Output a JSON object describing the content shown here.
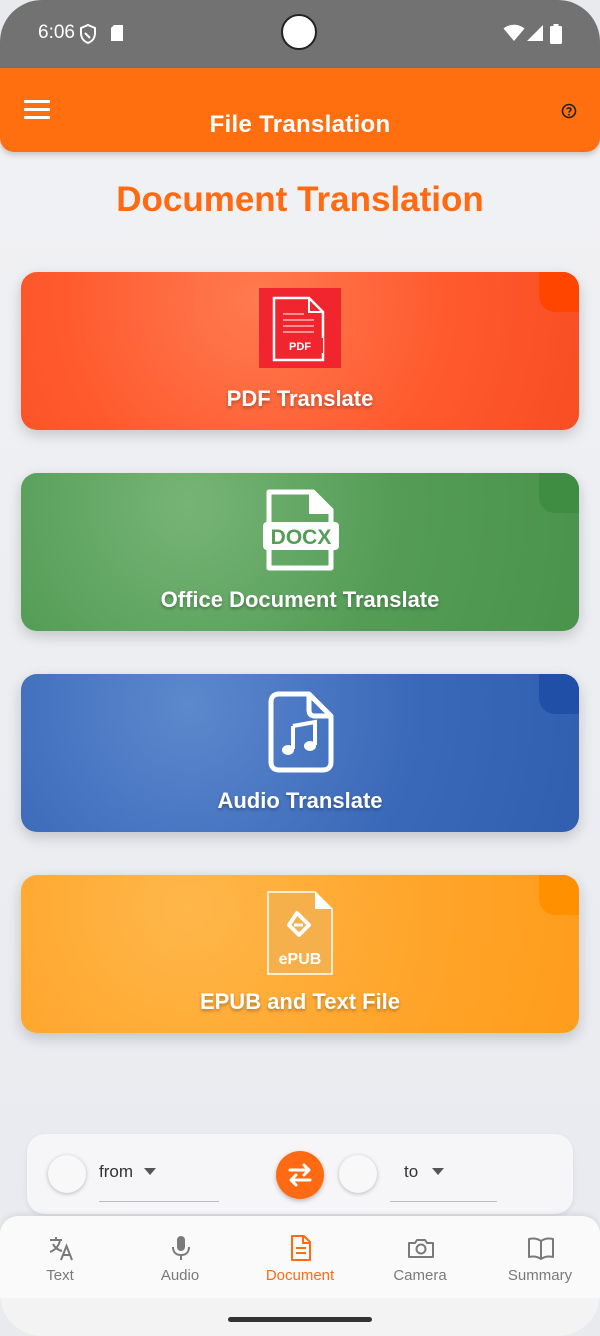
{
  "status_bar": {
    "time": "6:06",
    "icons": [
      "shield-icon",
      "sim-card-icon",
      "wifi-icon",
      "signal-icon",
      "battery-icon"
    ]
  },
  "app_bar": {
    "title": "File Translation",
    "menu_icon": "hamburger-menu-icon",
    "help_icon": "help-circle-icon"
  },
  "page_title": "Document Translation",
  "cards": [
    {
      "label": "PDF Translate",
      "icon": "pdf-file-icon",
      "icon_text": "PDF",
      "color": "#ff5a2e"
    },
    {
      "label": "Office Document Translate",
      "icon": "docx-file-icon",
      "icon_text": "DOCX",
      "color": "#559d57"
    },
    {
      "label": "Audio Translate",
      "icon": "audio-file-icon",
      "color": "#3b69b9"
    },
    {
      "label": "EPUB and Text File",
      "icon": "epub-file-icon",
      "icon_text": "ePUB",
      "color": "#ffa52b"
    }
  ],
  "language_bar": {
    "from_label": "from",
    "to_label": "to",
    "swap_icon": "swap-arrows-icon"
  },
  "bottom_nav": {
    "items": [
      {
        "label": "Text",
        "icon": "translate-icon",
        "active": false
      },
      {
        "label": "Audio",
        "icon": "microphone-icon",
        "active": false
      },
      {
        "label": "Document",
        "icon": "document-icon",
        "active": true
      },
      {
        "label": "Camera",
        "icon": "camera-icon",
        "active": false
      },
      {
        "label": "Summary",
        "icon": "book-icon",
        "active": false
      }
    ]
  },
  "colors": {
    "accent": "#ff6a12",
    "app_bar": "#ff6f0f",
    "status_bar": "#727272"
  }
}
